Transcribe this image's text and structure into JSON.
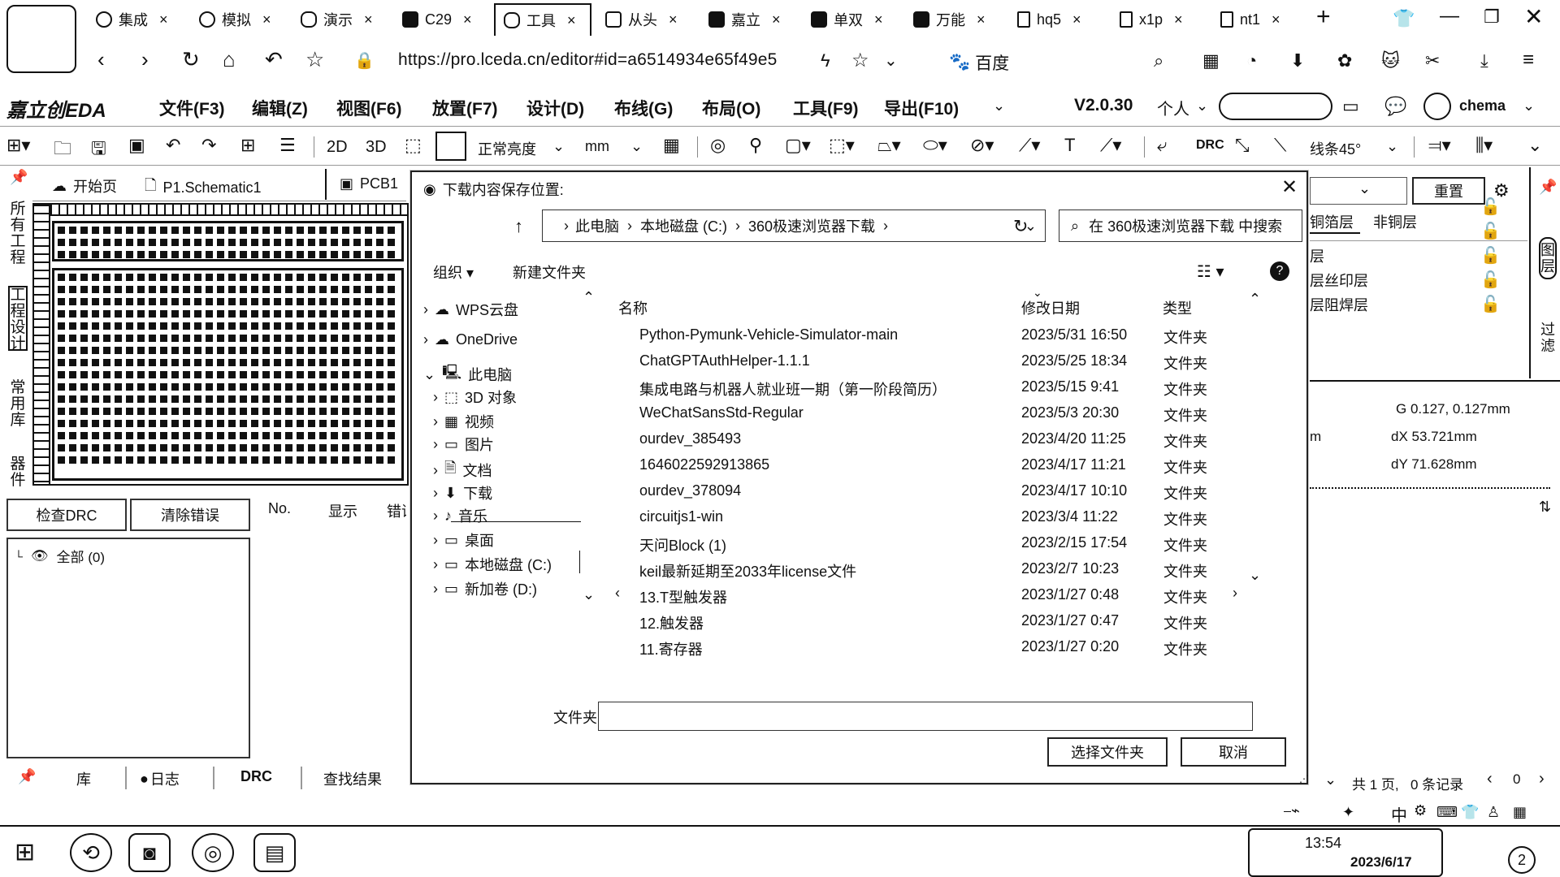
{
  "browser": {
    "tabs": [
      {
        "label": "集成"
      },
      {
        "label": "模拟"
      },
      {
        "label": "演示"
      },
      {
        "label": "C29"
      },
      {
        "label": "工具"
      },
      {
        "label": "从头"
      },
      {
        "label": "嘉立"
      },
      {
        "label": "单双"
      },
      {
        "label": "万能"
      },
      {
        "label": "hq5"
      },
      {
        "label": "x1p"
      },
      {
        "label": "nt1"
      }
    ],
    "url": "https://pro.lceda.cn/editor#id=a6514934e65f49e5",
    "search_engine_label": "百度",
    "new_tab_label": "+",
    "close_label": "×"
  },
  "app": {
    "brand": "嘉立创EDA",
    "menu": [
      "文件(F3)",
      "编辑(Z)",
      "视图(F6)",
      "放置(F7)",
      "设计(D)",
      "布线(G)",
      "布局(O)",
      "工具(F9)",
      "导出(F10)"
    ],
    "version": "V2.0.30",
    "user_label": "个人",
    "username": "chema",
    "toolbar": {
      "mode_2d": "2D",
      "mode_3d": "3D",
      "brightness": "正常亮度",
      "unit": "mm",
      "drc": "DRC",
      "route_angle": "线条45°"
    }
  },
  "left_panel": {
    "vertical_tabs": [
      "所有工程",
      "工程设计",
      "常用库",
      "器件"
    ],
    "doc_tabs": [
      "开始页",
      "P1.Schematic1",
      "PCB1"
    ],
    "drc": {
      "check_button": "检查DRC",
      "clear_button": "清除错误",
      "columns": [
        "No.",
        "显示",
        "错误"
      ],
      "tree_item": "全部 (0)"
    },
    "bottom_tabs": [
      "库",
      "日志",
      "DRC",
      "查找结果"
    ]
  },
  "right_panel": {
    "reset_button": "重置",
    "layers": [
      "铜箔层",
      "非铜层"
    ],
    "layer_rows": [
      "层",
      "层丝印层",
      "层阻焊层"
    ],
    "side_labels": [
      "图层",
      "过滤"
    ],
    "coords": {
      "g": "G  0.127, 0.127mm",
      "dx": "dX  53.721mm",
      "dy": "dY  71.628mm",
      "unit_partial": "m"
    },
    "pager": {
      "total_pages": "共 1 页,",
      "records": "0 条记录",
      "page_num": "0"
    }
  },
  "dialog": {
    "title": "下载内容保存位置:",
    "breadcrumb": [
      "此电脑",
      "本地磁盘 (C:)",
      "360极速浏览器下载"
    ],
    "search_placeholder": "在 360极速浏览器下载 中搜索",
    "organize": "组织",
    "new_folder": "新建文件夹",
    "nav_tree": [
      {
        "label": "WPS云盘"
      },
      {
        "label": "OneDrive"
      },
      {
        "label": "此电脑"
      },
      {
        "label": "3D 对象"
      },
      {
        "label": "视频"
      },
      {
        "label": "图片"
      },
      {
        "label": "文档"
      },
      {
        "label": "下载"
      },
      {
        "label": "音乐"
      },
      {
        "label": "桌面"
      },
      {
        "label": "本地磁盘 (C:)"
      },
      {
        "label": "新加卷 (D:)"
      }
    ],
    "columns": {
      "name": "名称",
      "date": "修改日期",
      "type": "类型"
    },
    "files": [
      {
        "name": "Python-Pymunk-Vehicle-Simulator-main",
        "date": "2023/5/31 16:50",
        "type": "文件夹"
      },
      {
        "name": "ChatGPTAuthHelper-1.1.1",
        "date": "2023/5/25 18:34",
        "type": "文件夹"
      },
      {
        "name": "集成电路与机器人就业班一期（第一阶段简历）",
        "date": "2023/5/15 9:41",
        "type": "文件夹"
      },
      {
        "name": "WeChatSansStd-Regular",
        "date": "2023/5/3 20:30",
        "type": "文件夹"
      },
      {
        "name": "ourdev_385493",
        "date": "2023/4/20 11:25",
        "type": "文件夹"
      },
      {
        "name": "1646022592913865",
        "date": "2023/4/17 11:21",
        "type": "文件夹"
      },
      {
        "name": "ourdev_378094",
        "date": "2023/4/17 10:10",
        "type": "文件夹"
      },
      {
        "name": "circuitjs1-win",
        "date": "2023/3/4 11:22",
        "type": "文件夹"
      },
      {
        "name": "天问Block (1)",
        "date": "2023/2/15 17:54",
        "type": "文件夹"
      },
      {
        "name": "keil最新延期至2033年license文件",
        "date": "2023/2/7 10:23",
        "type": "文件夹"
      },
      {
        "name": "13.T型触发器",
        "date": "2023/1/27 0:48",
        "type": "文件夹"
      },
      {
        "name": "12.触发器",
        "date": "2023/1/27 0:47",
        "type": "文件夹"
      },
      {
        "name": "11.寄存器",
        "date": "2023/1/27 0:20",
        "type": "文件夹"
      }
    ],
    "folder_label": "文件夹:",
    "folder_value": "",
    "select_button": "选择文件夹",
    "cancel_button": "取消"
  },
  "taskbar": {
    "clock_time": "13:54",
    "clock_date": "2023/6/17",
    "ime": "中"
  }
}
